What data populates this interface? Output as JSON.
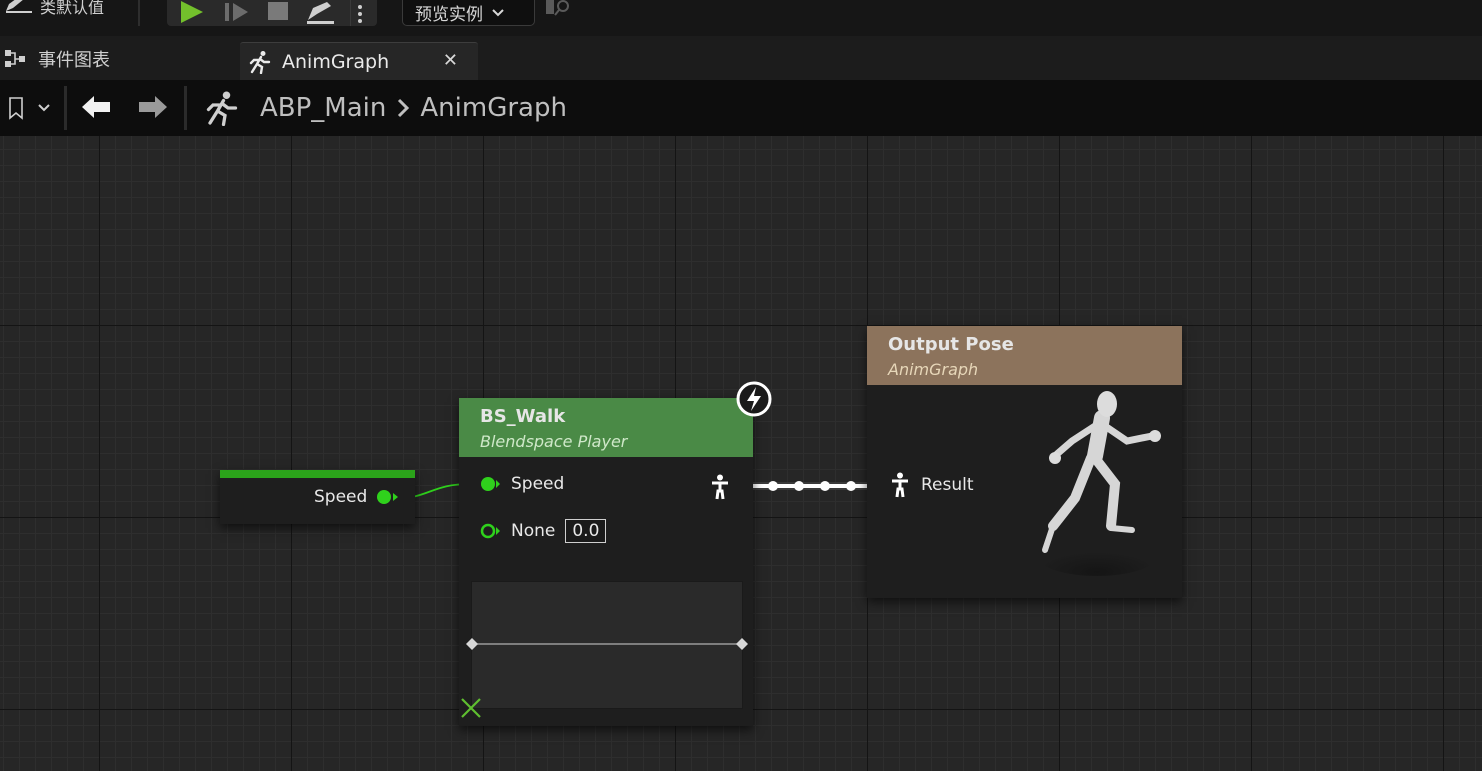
{
  "toolbar": {
    "defaults_label": "类默认值",
    "preview_instance_label": "预览实例"
  },
  "tabs": [
    {
      "label": "事件图表"
    },
    {
      "label": "AnimGraph"
    }
  ],
  "breadcrumb": {
    "blueprint": "ABP_Main",
    "graph": "AnimGraph"
  },
  "graph": {
    "speed_var_node": {
      "pin_label": "Speed"
    },
    "blendspace_node": {
      "title": "BS_Walk",
      "subtitle": "Blendspace Player",
      "pin_speed": "Speed",
      "pin_none": "None",
      "pin_none_value": "0.0"
    },
    "output_pose_node": {
      "title": "Output Pose",
      "subtitle": "AnimGraph",
      "pin_result": "Result"
    }
  },
  "colors": {
    "float_pin": "#2fd11c",
    "blendspace_header": "#4a8a46",
    "output_header": "#8c735c",
    "play_green": "#73c02c"
  }
}
